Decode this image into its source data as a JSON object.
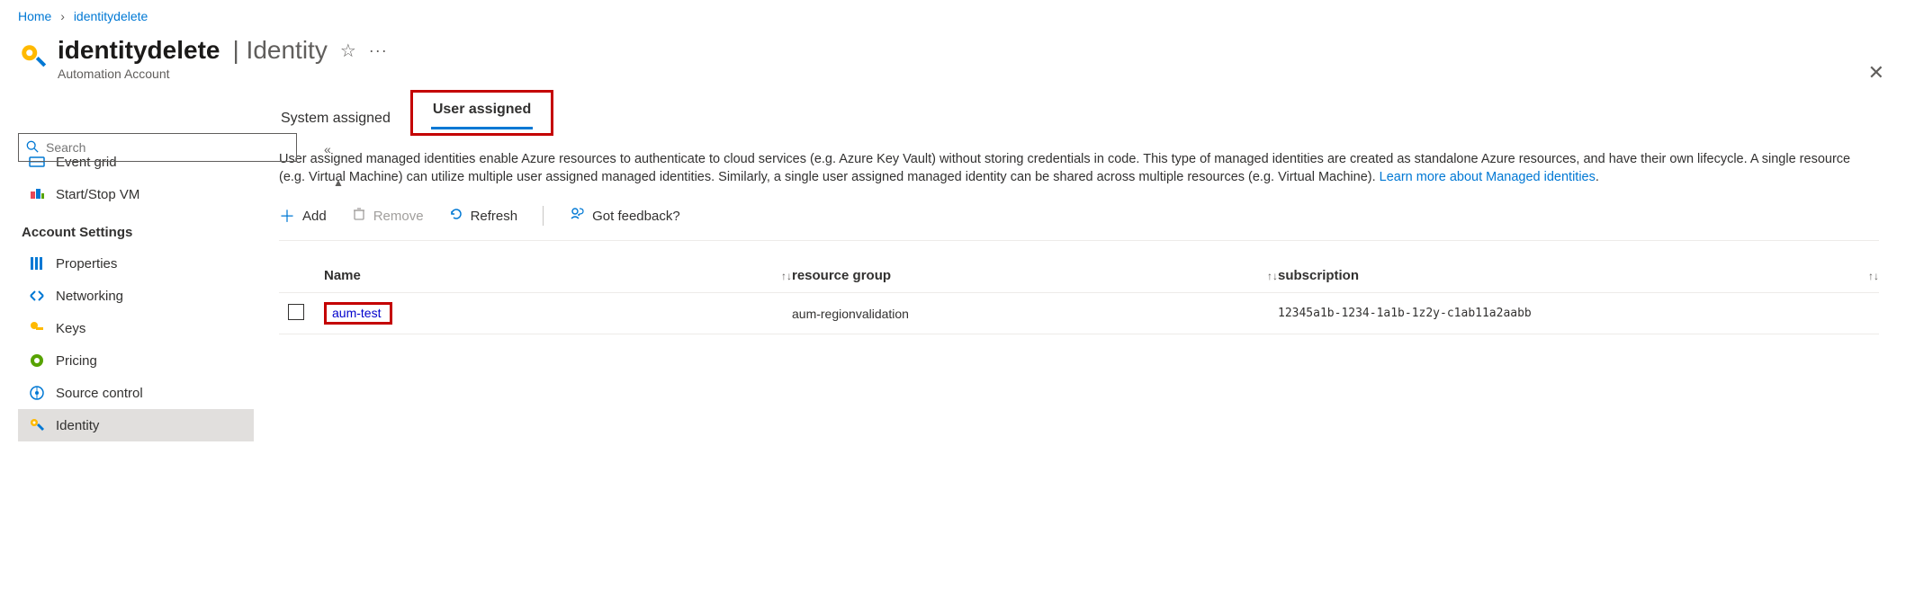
{
  "breadcrumb": {
    "home": "Home",
    "current": "identitydelete"
  },
  "header": {
    "title": "identitydelete",
    "section": "Identity",
    "subtitle": "Automation Account"
  },
  "sidebar": {
    "search_placeholder": "Search",
    "items_top": [
      {
        "label": "Event grid"
      },
      {
        "label": "Start/Stop VM"
      }
    ],
    "heading": "Account Settings",
    "items": [
      {
        "label": "Properties"
      },
      {
        "label": "Networking"
      },
      {
        "label": "Keys"
      },
      {
        "label": "Pricing"
      },
      {
        "label": "Source control"
      },
      {
        "label": "Identity"
      }
    ]
  },
  "tabs": {
    "system": "System assigned",
    "user": "User assigned"
  },
  "desc": {
    "text": "User assigned managed identities enable Azure resources to authenticate to cloud services (e.g. Azure Key Vault) without storing credentials in code. This type of managed identities are created as standalone Azure resources, and have their own lifecycle. A single resource (e.g. Virtual Machine) can utilize multiple user assigned managed identities. Similarly, a single user assigned managed identity can be shared across multiple resources (e.g. Virtual Machine). ",
    "link": "Learn more about Managed identities"
  },
  "toolbar": {
    "add": "Add",
    "remove": "Remove",
    "refresh": "Refresh",
    "feedback": "Got feedback?"
  },
  "table": {
    "head": {
      "name": "Name",
      "rg": "resource group",
      "sub": "subscription"
    },
    "row": {
      "name": "aum-test",
      "rg": "aum-regionvalidation",
      "sub": "12345a1b-1234-1a1b-1z2y-c1ab11a2aabb"
    }
  }
}
